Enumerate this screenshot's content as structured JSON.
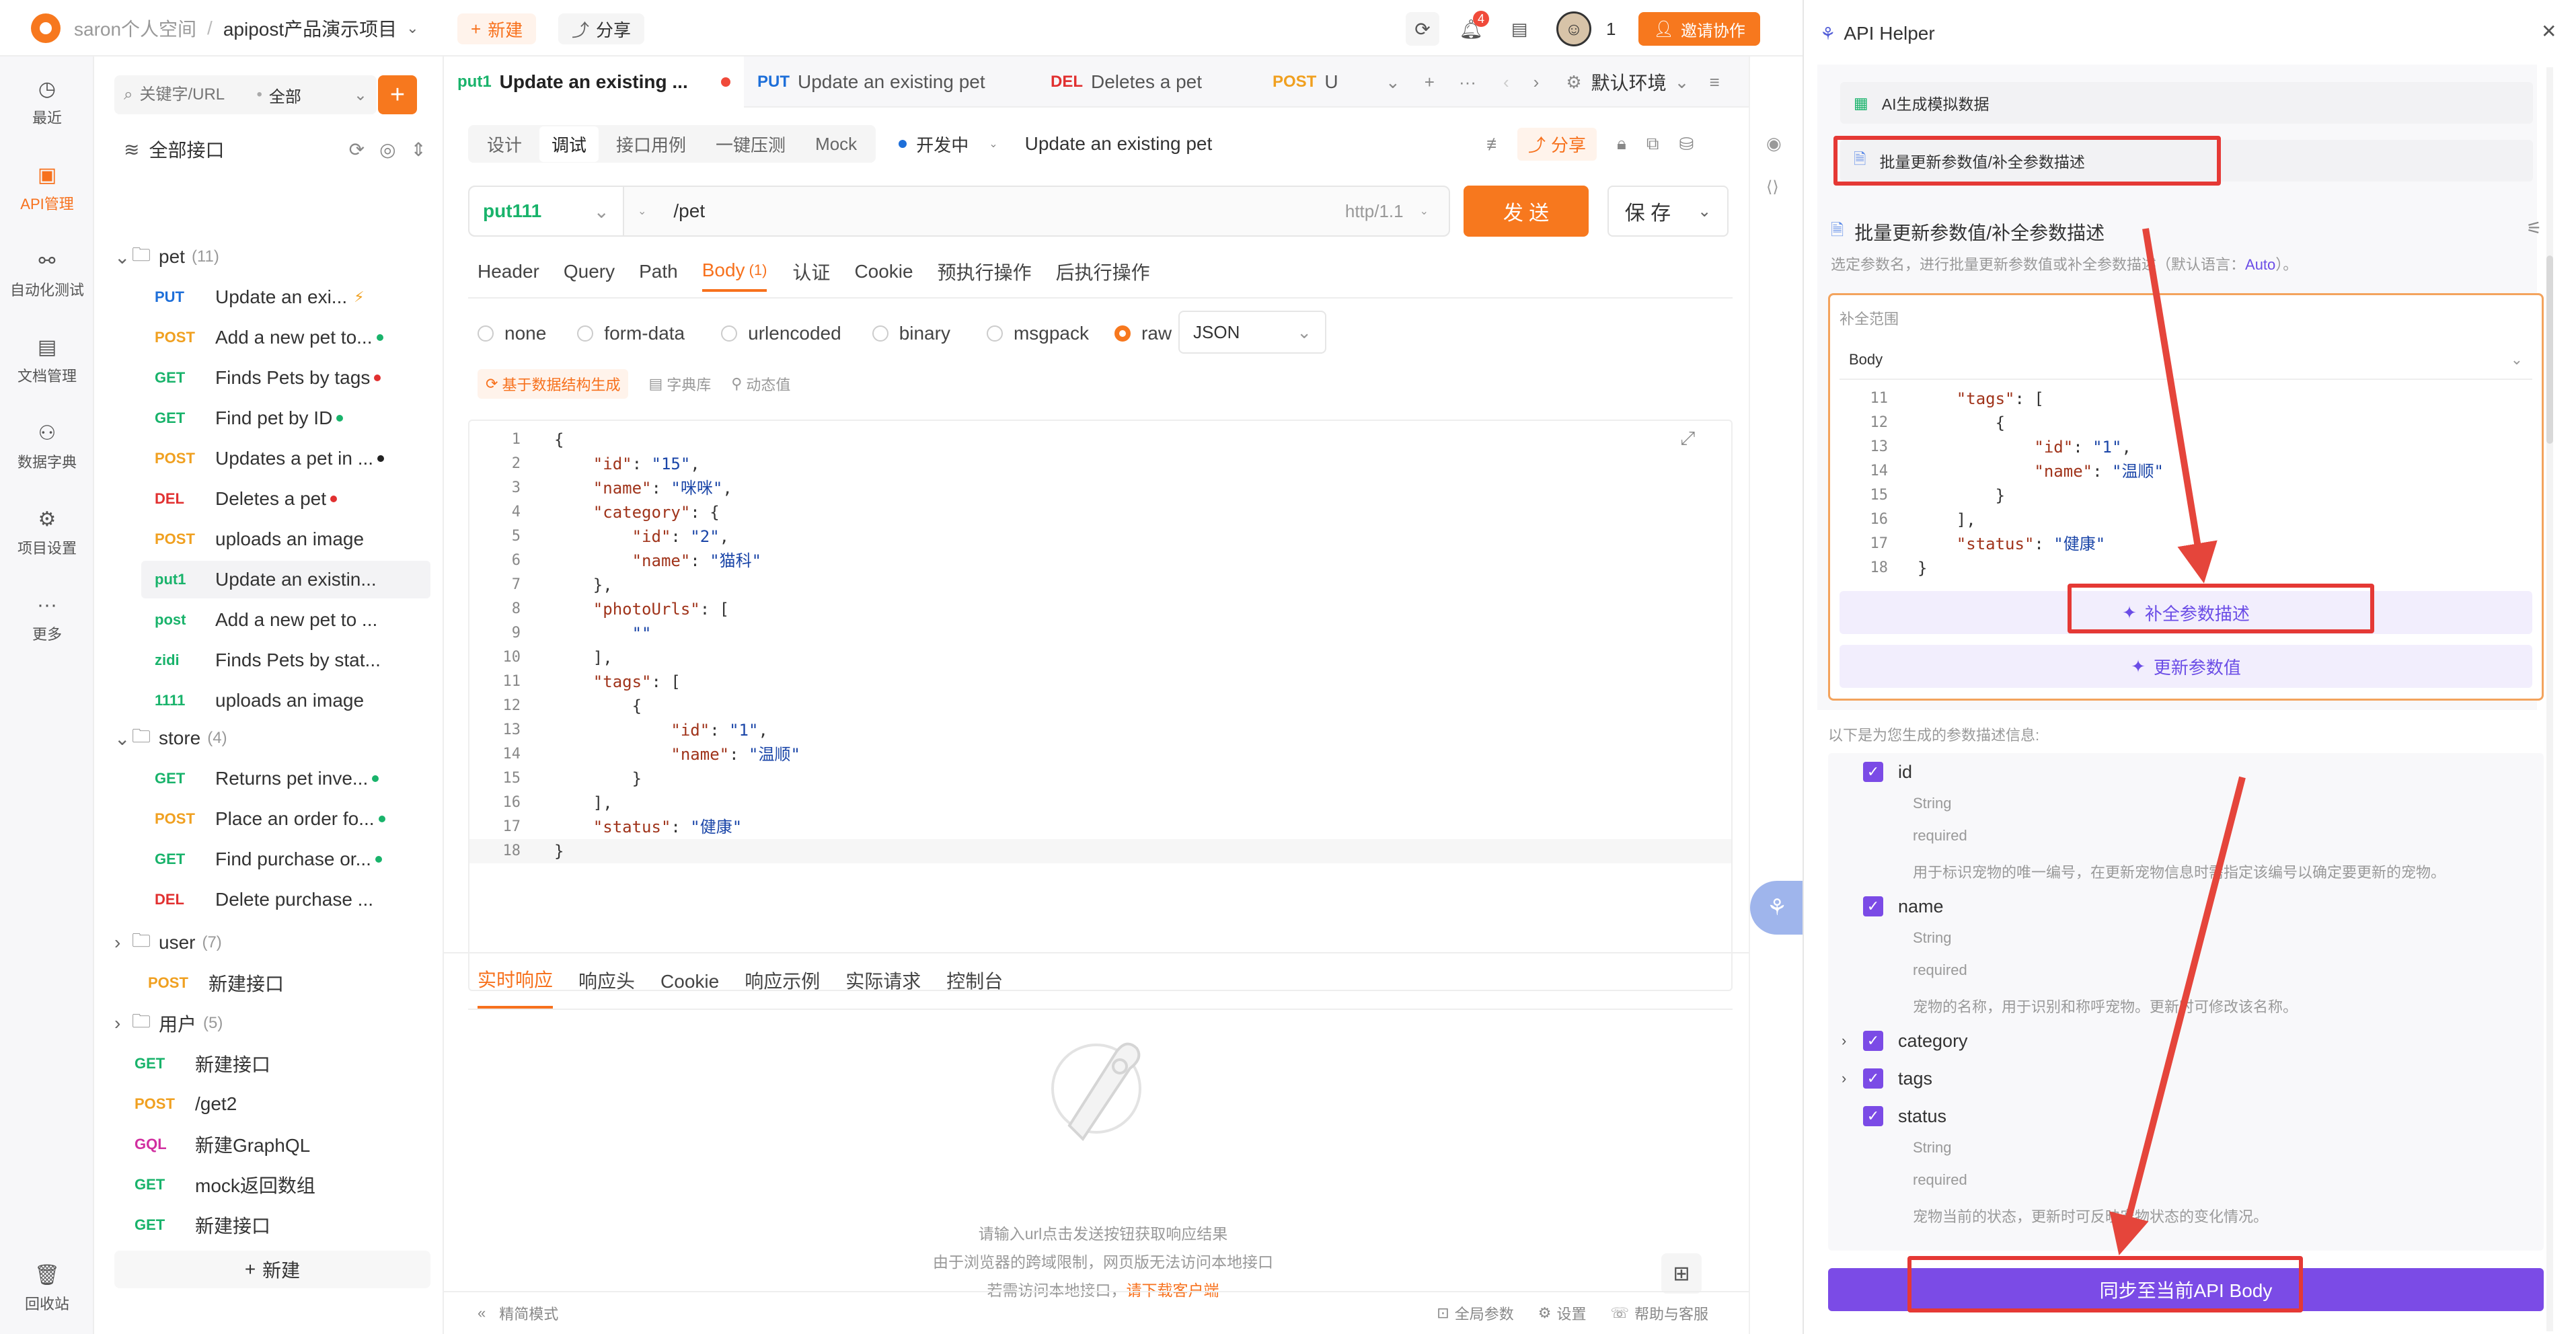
{
  "topbar": {
    "workspace": "saron个人空间",
    "project": "apipost产品演示项目",
    "new_label": "新建",
    "share_label": "分享",
    "notif_count": "4",
    "member_count": "1",
    "invite_label": "邀请协作"
  },
  "leftnav": [
    {
      "icon": "clock-icon",
      "label": "最近"
    },
    {
      "icon": "api-icon",
      "label": "API管理"
    },
    {
      "icon": "automation-icon",
      "label": "自动化测试"
    },
    {
      "icon": "doc-icon",
      "label": "文档管理"
    },
    {
      "icon": "dictionary-icon",
      "label": "数据字典"
    },
    {
      "icon": "project-settings-icon",
      "label": "项目设置"
    },
    {
      "icon": "more-icon",
      "label": "更多"
    },
    {
      "icon": "trash-icon",
      "label": "回收站"
    }
  ],
  "tree": {
    "search_placeholder": "关键字/URL",
    "filter": "全部",
    "root": "全部接口",
    "pet_folder": "pet",
    "pet_count": "(11)",
    "pet_items": [
      {
        "method": "PUT",
        "cls": "m-put",
        "name": "Update an exi...",
        "dot": "#f0a020"
      },
      {
        "method": "POST",
        "cls": "m-post",
        "name": "Add a new pet to...",
        "dot": "#19b36b"
      },
      {
        "method": "GET",
        "cls": "m-get",
        "name": "Finds Pets by tags",
        "dot": "#e13030"
      },
      {
        "method": "GET",
        "cls": "m-get",
        "name": "Find pet by ID",
        "dot": "#19b36b"
      },
      {
        "method": "POST",
        "cls": "m-post",
        "name": "Updates a pet in ...",
        "dot": "#222"
      },
      {
        "method": "DEL",
        "cls": "m-del",
        "name": "Deletes a pet",
        "dot": "#e13030"
      },
      {
        "method": "POST",
        "cls": "m-post",
        "name": "uploads an image",
        "dot": ""
      },
      {
        "method": "put1",
        "cls": "m-get",
        "name": "Update an existin...",
        "dot": ""
      },
      {
        "method": "post",
        "cls": "m-get",
        "name": "Add a new pet to ...",
        "dot": ""
      },
      {
        "method": "zidi",
        "cls": "m-get",
        "name": "Finds Pets by stat...",
        "dot": ""
      },
      {
        "method": "1111",
        "cls": "m-get",
        "name": "uploads an image",
        "dot": ""
      }
    ],
    "store_folder": "store",
    "store_count": "(4)",
    "store_items": [
      {
        "method": "GET",
        "cls": "m-get",
        "name": "Returns pet inve...",
        "dot": "#19b36b"
      },
      {
        "method": "POST",
        "cls": "m-post",
        "name": "Place an order fo...",
        "dot": "#19b36b"
      },
      {
        "method": "GET",
        "cls": "m-get",
        "name": "Find purchase or...",
        "dot": "#19b36b"
      },
      {
        "method": "DEL",
        "cls": "m-del",
        "name": "Delete purchase ...",
        "dot": ""
      }
    ],
    "user_folder": "user",
    "user_count": "(7)",
    "loose1": {
      "method": "POST",
      "cls": "m-post",
      "name": "新建接口"
    },
    "yonghu_folder": "用户",
    "yonghu_count": "(5)",
    "loose_items": [
      {
        "method": "GET",
        "cls": "m-get",
        "name": "新建接口"
      },
      {
        "method": "POST",
        "cls": "m-post",
        "name": "/get2"
      },
      {
        "method": "GQL",
        "cls": "m-gql",
        "name": "新建GraphQL"
      },
      {
        "method": "GET",
        "cls": "m-get",
        "name": "mock返回数组"
      },
      {
        "method": "GET",
        "cls": "m-get",
        "name": "新建接口"
      }
    ],
    "add_label": "新建"
  },
  "tabs": [
    {
      "method": "put1",
      "cls": "m-get",
      "name": "Update an existing ..."
    },
    {
      "method": "PUT",
      "cls": "m-put",
      "name": "Update an existing pet"
    },
    {
      "method": "DEL",
      "cls": "m-del",
      "name": "Deletes a pet"
    },
    {
      "method": "POST",
      "cls": "m-post",
      "name": "U"
    }
  ],
  "env": "默认环境",
  "subtabs": [
    "设计",
    "调试",
    "接口用例",
    "一键压测",
    "Mock"
  ],
  "status": "开发中",
  "api_name": "Update an existing pet",
  "share_label": "分享",
  "request": {
    "method": "put111",
    "url": "/pet",
    "protocol": "http/1.1",
    "send": "发 送",
    "save": "保 存"
  },
  "param_tabs": [
    "Header",
    "Query",
    "Path",
    "Body",
    "认证",
    "Cookie",
    "预执行操作",
    "后执行操作"
  ],
  "body_count": "(1)",
  "body_types": [
    "none",
    "form-data",
    "urlencoded",
    "binary",
    "msgpack",
    "raw"
  ],
  "body_format": "JSON",
  "body_tools": [
    "基于数据结构生成",
    "字典库",
    "动态值"
  ],
  "code": [
    "{",
    "    \"id\": \"15\",",
    "    \"name\": \"咪咪\",",
    "    \"category\": {",
    "        \"id\": \"2\",",
    "        \"name\": \"猫科\"",
    "    },",
    "    \"photoUrls\": [",
    "        \"\"",
    "    ],",
    "    \"tags\": [",
    "        {",
    "            \"id\": \"1\",",
    "            \"name\": \"温顺\"",
    "        }",
    "    ],",
    "    \"status\": \"健康\"",
    "}"
  ],
  "resp_tabs": [
    "实时响应",
    "响应头",
    "Cookie",
    "响应示例",
    "实际请求",
    "控制台"
  ],
  "resp_empty": [
    "请输入url点击发送按钮获取响应结果",
    "由于浏览器的跨域限制，网页版无法访问本地接口",
    "若需访问本地接口，"
  ],
  "resp_download": "请下载客户端",
  "footer": {
    "left": "精简模式",
    "global_params": "全局参数",
    "settings": "设置",
    "help": "帮助与客服"
  },
  "helper": {
    "title": "API Helper",
    "menu1": "AI生成模拟数据",
    "menu2": "批量更新参数值/补全参数描述",
    "section_title": "批量更新参数值/补全参数描述",
    "section_desc": "选定参数名，进行批量更新参数值或补全参数描述（默认语言：",
    "section_lang": "Auto",
    "section_desc_end": "）。",
    "scope_label": "补全范围",
    "scope_value": "Body",
    "code_start": 11,
    "code": [
      "    \"tags\": [",
      "        {",
      "            \"id\": \"1\",",
      "            \"name\": \"温顺\"",
      "        }",
      "    ],",
      "    \"status\": \"健康\"",
      "}"
    ],
    "btn_complete": "补全参数描述",
    "btn_update": "更新参数值",
    "result_intro": "以下是为您生成的参数描述信息:",
    "params": [
      {
        "name": "id",
        "type": "String",
        "req": "required",
        "desc": "用于标识宠物的唯一编号，在更新宠物信息时需指定该编号以确定要更新的宠物。"
      },
      {
        "name": "name",
        "type": "String",
        "req": "required",
        "desc": "宠物的名称，用于识别和称呼宠物。更新时可修改该名称。"
      },
      {
        "name": "category"
      },
      {
        "name": "tags"
      },
      {
        "name": "status",
        "type": "String",
        "req": "required",
        "desc": "宠物当前的状态，更新时可反映宠物状态的变化情况。"
      }
    ],
    "sync_label": "同步至当前API Body"
  }
}
